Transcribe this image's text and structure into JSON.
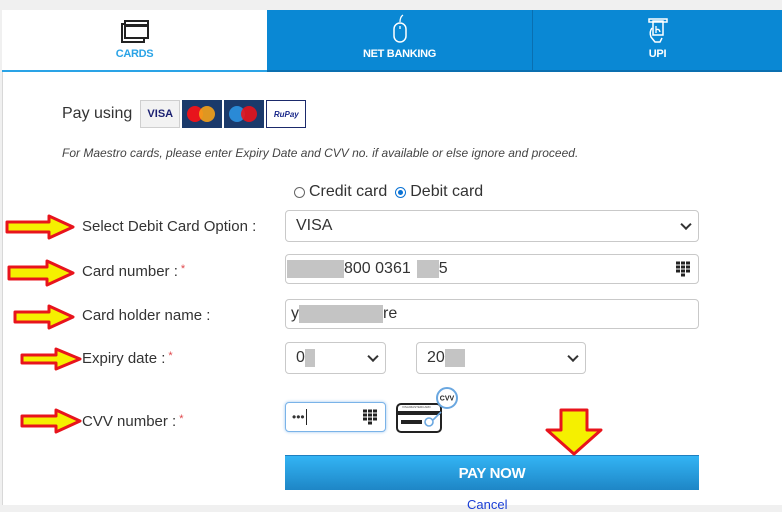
{
  "tabs": [
    {
      "label": "CARDS",
      "icon": "credit-card-icon",
      "active": true
    },
    {
      "label": "NET BANKING",
      "icon": "mouse-icon",
      "active": false
    },
    {
      "label": "UPI",
      "icon": "upi-hand-icon",
      "active": false
    }
  ],
  "pay_using": {
    "label": "Pay using",
    "logos": [
      "VISA",
      "MasterCard",
      "Maestro",
      "RuPay"
    ]
  },
  "maestro_note": "For Maestro cards, please enter Expiry Date and CVV no. if available or else ignore and proceed.",
  "card_type": {
    "options": [
      "Credit card",
      "Debit card"
    ],
    "selected": "Debit card"
  },
  "form": {
    "card_option_label": "Select Debit Card Option :",
    "card_option_value": "VISA",
    "card_number_label": "Card number :",
    "card_number_visible": "800 0361",
    "card_number_tail": "5",
    "card_holder_label": "Card holder name :",
    "card_holder_head": "y",
    "card_holder_tail": "re",
    "expiry_label": "Expiry date :",
    "expiry_month_prefix": "0",
    "expiry_year_prefix": "20",
    "cvv_label": "CVV number :",
    "cvv_value": "•••",
    "required_mark": "*",
    "cvv_help_badge": "CVV",
    "cvv_help_card_text": "VISA/MASTERCARD"
  },
  "pay_button": "PAY NOW",
  "cancel_link": "Cancel",
  "colors": {
    "tab_active_text": "#2aa3e6",
    "tab_inactive_bg": "#0a88d4",
    "pay_button_top": "#33b4f4",
    "pay_button_bottom": "#1e86c6",
    "annotation_arrow_fill": "#f5f000",
    "annotation_arrow_stroke": "#e8141c"
  }
}
